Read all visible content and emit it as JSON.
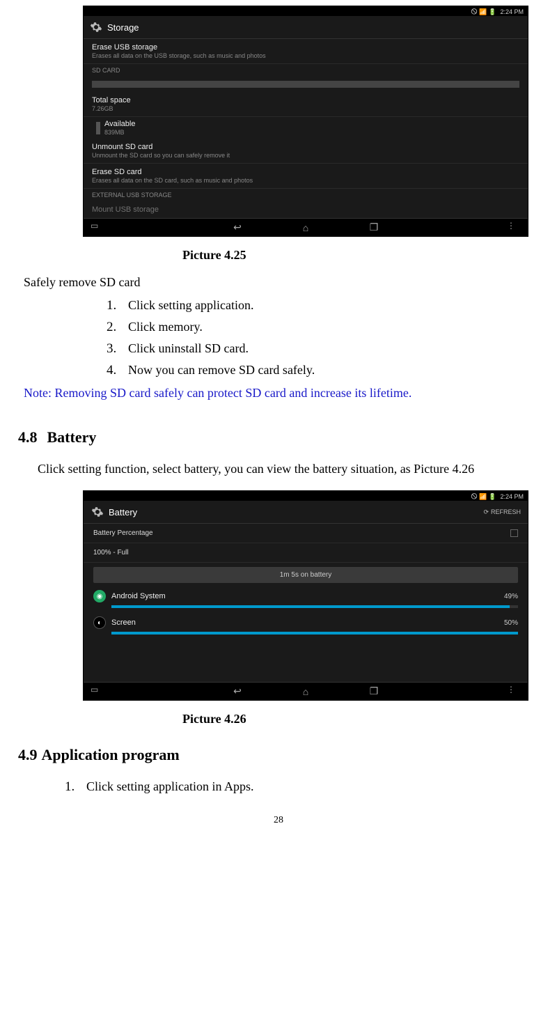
{
  "screenshot1": {
    "status": {
      "time": "2:24 PM",
      "indicators": "🛇 📶 🔋"
    },
    "header": "Storage",
    "erase_usb": {
      "title": "Erase USB storage",
      "sub": "Erases all data on the USB storage, such as music and photos"
    },
    "sd_card_header": "SD CARD",
    "total": {
      "title": "Total space",
      "value": "7.26GB"
    },
    "avail": {
      "title": "Available",
      "value": "839MB"
    },
    "unmount": {
      "title": "Unmount SD card",
      "sub": "Unmount the SD card so you can safely remove it"
    },
    "erase_sd": {
      "title": "Erase SD card",
      "sub": "Erases all data on the SD card, such as music and photos"
    },
    "ext_header": "EXTERNAL USB STORAGE",
    "mount": {
      "title": "Mount USB storage"
    }
  },
  "caption1": "Picture 4.25",
  "safely_remove": "Safely remove SD card",
  "steps": [
    "Click setting application.",
    "Click memory.",
    "Click uninstall SD card.",
    "Now you can remove SD card safely."
  ],
  "note": "Note: Removing SD card safely can protect SD card and increase its lifetime.",
  "section48": {
    "num": "4.8",
    "title": "Battery"
  },
  "lead48": "Click setting function, select battery, you can view the battery situation, as Picture 4.26",
  "screenshot2": {
    "status": {
      "time": "2:24 PM",
      "indicators": "🛇 📶 🔋"
    },
    "header": "Battery",
    "refresh": "REFRESH",
    "percentage_label": "Battery Percentage",
    "full": "100% - Full",
    "banner": "1m 5s on battery",
    "rows": [
      {
        "label": "Android System",
        "pct": "49%",
        "fill": 98
      },
      {
        "label": "Screen",
        "pct": "50%",
        "fill": 100
      }
    ]
  },
  "caption2": "Picture 4.26",
  "section49": {
    "num": "4.9",
    "title": "Application program"
  },
  "steps49": [
    "Click setting application in Apps."
  ],
  "page_number": "28"
}
